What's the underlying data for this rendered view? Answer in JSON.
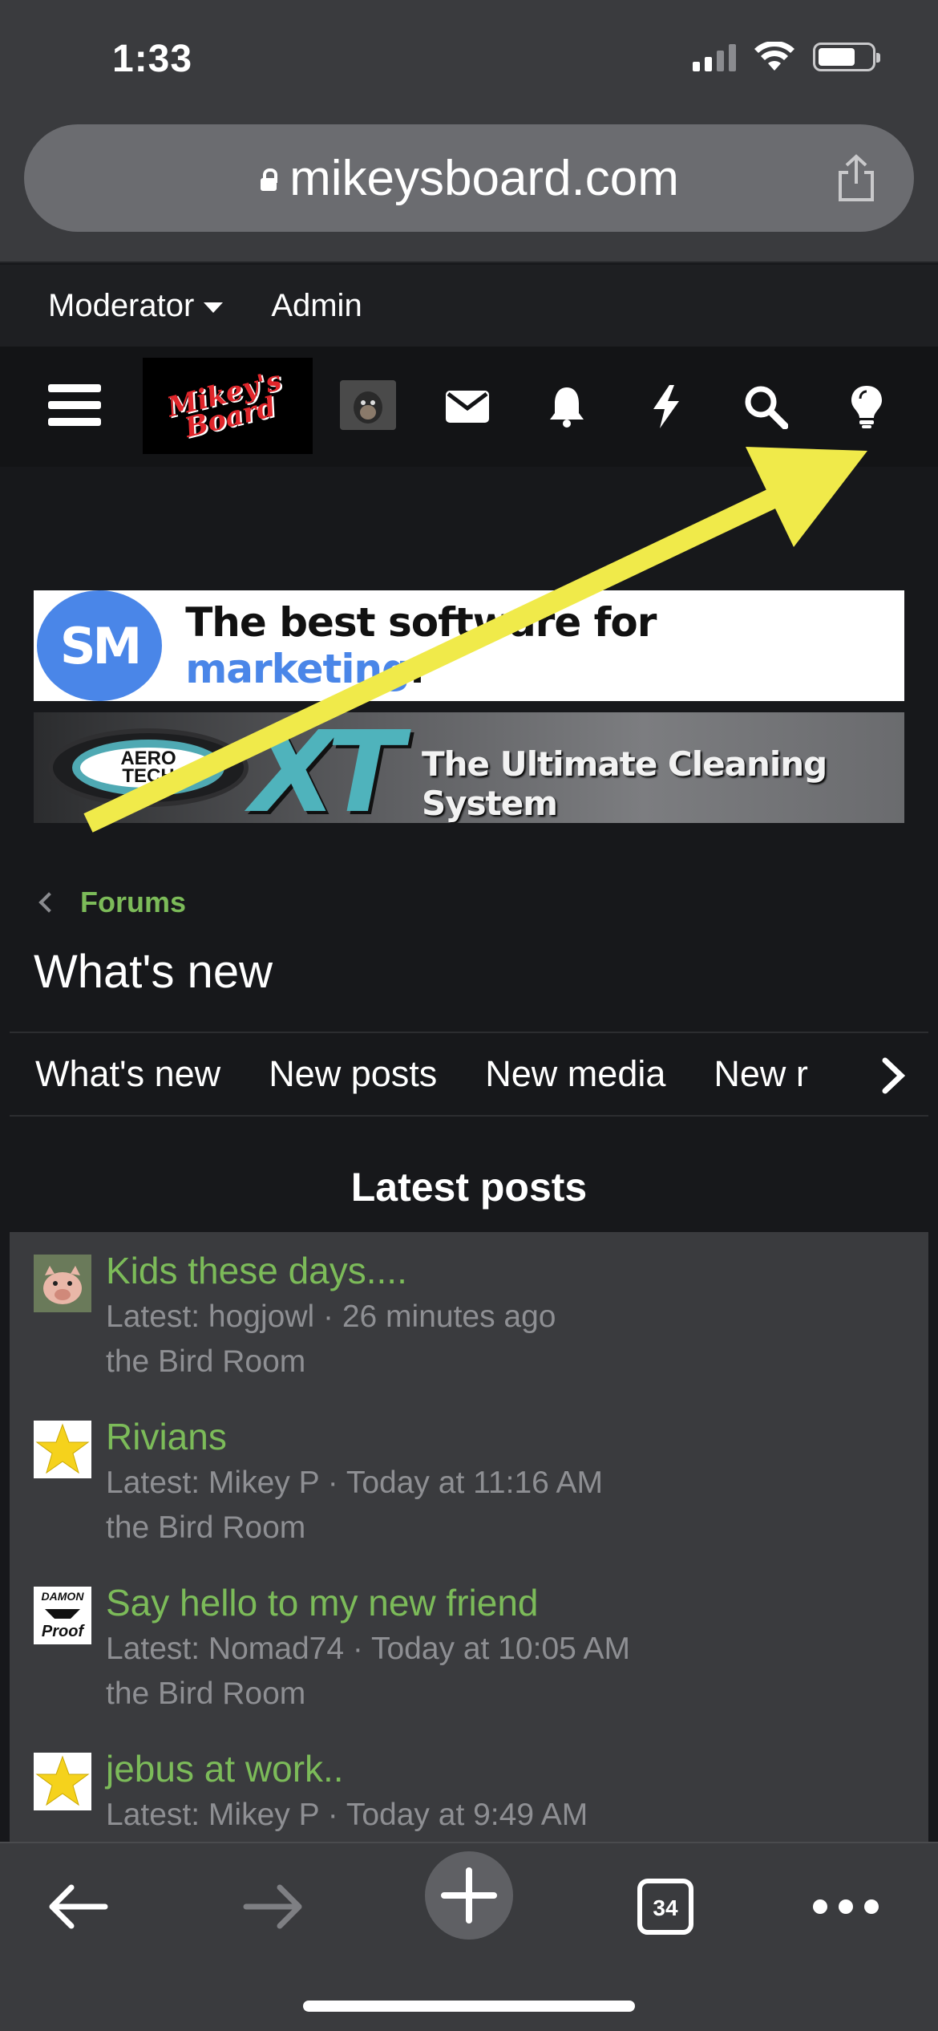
{
  "status_bar": {
    "time": "1:33"
  },
  "browser": {
    "url": "mikeysboard.com"
  },
  "moderator_bar": {
    "moderator_label": "Moderator",
    "admin_label": "Admin"
  },
  "nav": {
    "logo_text_line1": "Mikey's",
    "logo_text_line2": "Board",
    "icons": [
      "menu-icon",
      "mail-icon",
      "bell-icon",
      "bolt-icon",
      "search-icon",
      "lightbulb-icon"
    ]
  },
  "ads": {
    "sm_logo": "SM",
    "sm_text_prefix": "The best software for ",
    "sm_text_highlight": "marketing",
    "sm_text_suffix": ".",
    "xt_logo_line1": "AERO",
    "xt_logo_line2": "TECH",
    "xt_big": "XT",
    "xt_tagline": "The Ultimate Cleaning System"
  },
  "breadcrumb": {
    "label": "Forums"
  },
  "page": {
    "title": "What's new"
  },
  "tabs": [
    "What's new",
    "New posts",
    "New media",
    "New r"
  ],
  "latest": {
    "heading": "Latest posts",
    "posts": [
      {
        "title": "Kids these days....",
        "meta": "Latest: hogjowl · 26 minutes ago",
        "forum": "the Bird Room",
        "avatar": "pig"
      },
      {
        "title": "Rivians",
        "meta": "Latest: Mikey P · Today at 11:16 AM",
        "forum": "the Bird Room",
        "avatar": "star"
      },
      {
        "title": "Say hello to my new friend",
        "meta": "Latest: Nomad74 · Today at 10:05 AM",
        "forum": "the Bird Room",
        "avatar": "damon"
      },
      {
        "title": "jebus at work..",
        "meta": "Latest: Mikey P · Today at 9:49 AM",
        "forum": "",
        "avatar": "star"
      }
    ],
    "damon_line1": "DAMON",
    "damon_line2": "Proof"
  },
  "toolbar": {
    "tab_count": "34"
  },
  "colors": {
    "link_green": "#7cbb59",
    "arrow_yellow": "#f0ea4a",
    "bg_dark": "#17181b"
  }
}
